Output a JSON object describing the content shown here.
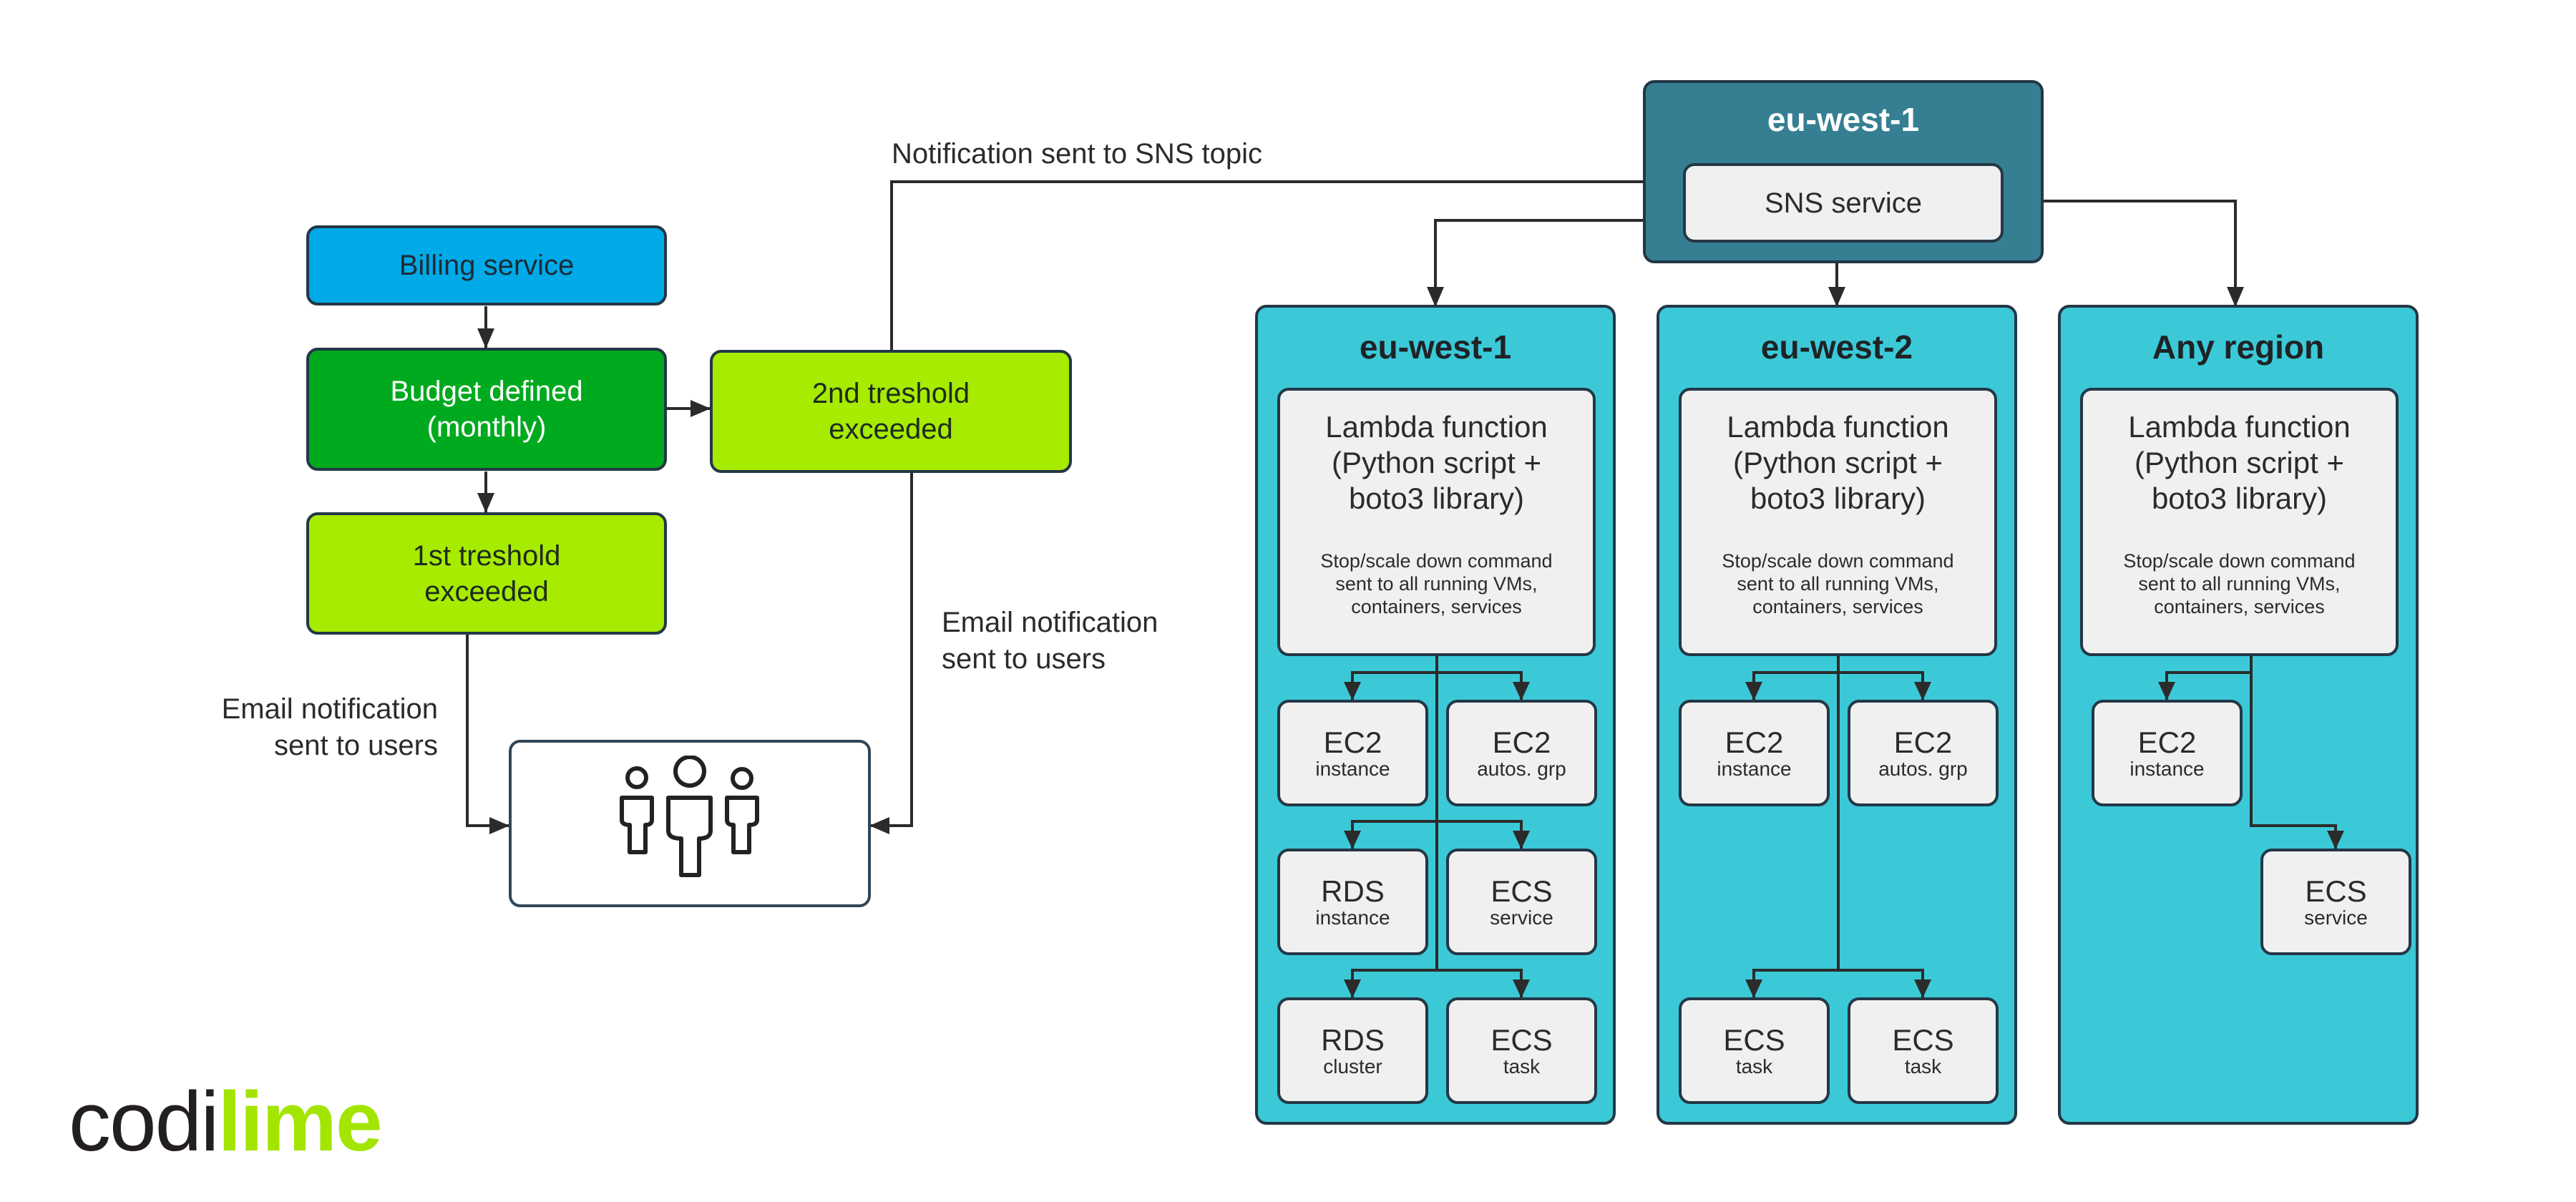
{
  "flow": {
    "billing": "Billing service",
    "budget": "Budget defined\n(monthly)",
    "threshold_1": "1st treshold\nexceeded",
    "threshold_2": "2nd treshold\nexceeded",
    "users_icon": "users-group-icon"
  },
  "labels": {
    "sns_notification": "Notification sent to SNS topic",
    "email_left": "Email notification\nsent to users",
    "email_right": "Email notification\nsent to users"
  },
  "sns": {
    "region": "eu-west-1",
    "service": "SNS service"
  },
  "regions": [
    {
      "title": "eu-west-1",
      "lambda_title": "Lambda function\n(Python script +\nboto3 library)",
      "lambda_note": "Stop/scale down command\nsent to all running VMs,\ncontainers, services",
      "services": [
        {
          "name": "EC2",
          "sub": "instance"
        },
        {
          "name": "EC2",
          "sub": "autos. grp"
        },
        {
          "name": "RDS",
          "sub": "instance"
        },
        {
          "name": "ECS",
          "sub": "service"
        },
        {
          "name": "RDS",
          "sub": "cluster"
        },
        {
          "name": "ECS",
          "sub": "task"
        }
      ]
    },
    {
      "title": "eu-west-2",
      "lambda_title": "Lambda function\n(Python script +\nboto3 library)",
      "lambda_note": "Stop/scale down command\nsent to all running VMs,\ncontainers, services",
      "services": [
        {
          "name": "EC2",
          "sub": "instance"
        },
        {
          "name": "EC2",
          "sub": "autos. grp"
        },
        {
          "name": "ECS",
          "sub": "task"
        },
        {
          "name": "ECS",
          "sub": "task"
        }
      ]
    },
    {
      "title": "Any region",
      "lambda_title": "Lambda function\n(Python script +\nboto3 library)",
      "lambda_note": "Stop/scale down command\nsent to all running VMs,\ncontainers, services",
      "services": [
        {
          "name": "EC2",
          "sub": "instance"
        },
        {
          "name": "ECS",
          "sub": "service"
        }
      ]
    }
  ],
  "logo": {
    "part1": "codi",
    "part2": "lime"
  },
  "colors": {
    "billing": "#00aae8",
    "budget": "#00aa1e",
    "threshold": "#a6eb00",
    "region": "#3bc9d8",
    "sns_region": "#367f92",
    "card": "#f0f0f0",
    "lime": "#a3e500"
  }
}
